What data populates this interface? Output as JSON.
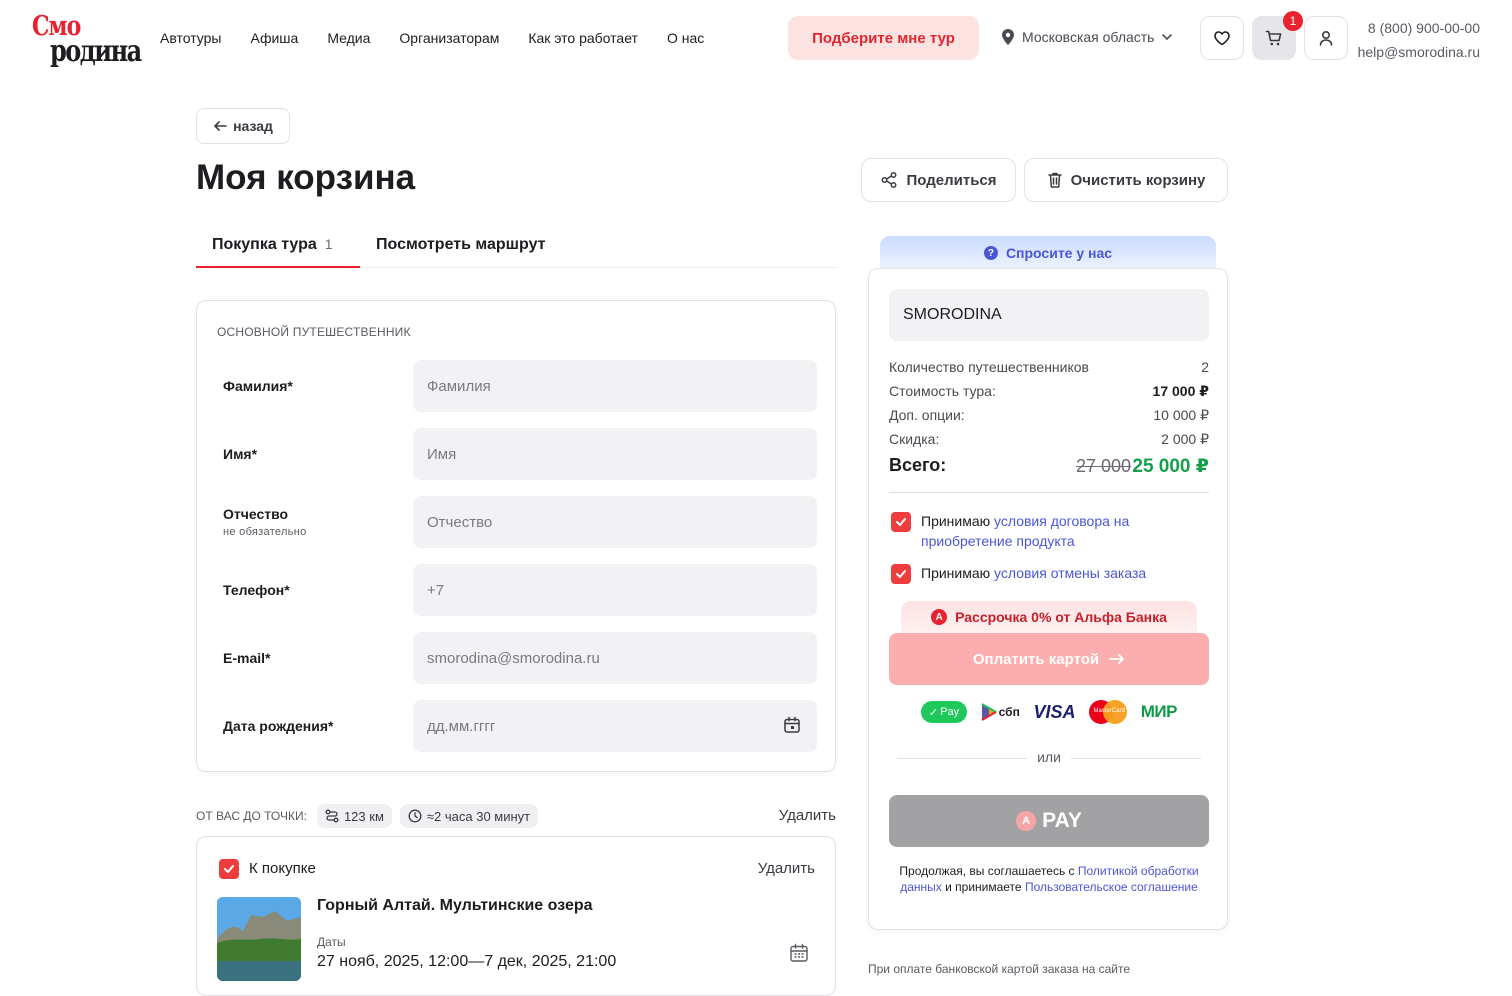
{
  "header": {
    "logo_top": "Смо",
    "logo_bottom": "родина",
    "nav": [
      "Автотуры",
      "Афиша",
      "Медиа",
      "Организаторам",
      "Как это работает",
      "О нас"
    ],
    "pick_tour": "Подберите мне тур",
    "region": "Московская область",
    "cart_count": "1",
    "phone": "8 (800) 900-00-00",
    "email": "help@smorodina.ru"
  },
  "main": {
    "back": "назад",
    "title": "Моя корзина",
    "share": "Поделиться",
    "clear_cart": "Очистить корзину",
    "tabs": [
      {
        "label": "Покупка тура",
        "count": "1"
      },
      {
        "label": "Посмотреть маршрут"
      }
    ]
  },
  "form": {
    "heading": "ОСНОВНОЙ ПУТЕШЕСТВЕННИК",
    "fields": [
      {
        "label": "Фамилия*",
        "placeholder": "Фамилия"
      },
      {
        "label": "Имя*",
        "placeholder": "Имя"
      },
      {
        "label": "Отчество",
        "sublabel": "не обязательно",
        "placeholder": "Отчество"
      },
      {
        "label": "Телефон*",
        "placeholder": "+7"
      },
      {
        "label": "E-mail*",
        "placeholder": "smorodina@smorodina.ru"
      },
      {
        "label": "Дата рождения*",
        "placeholder": "дд.мм.гггг"
      }
    ]
  },
  "distance": {
    "label": "ОТ ВАС ДО ТОЧКИ:",
    "km": "123 км",
    "time": "≈2 часа 30 минут",
    "delete": "Удалить"
  },
  "tour": {
    "buy_label": "К покупке",
    "delete": "Удалить",
    "name": "Горный Алтай. Мультинские озера",
    "dates_label": "Даты",
    "dates": "27 нояб, 2025, 12:00—7 дек, 2025, 21:00"
  },
  "summary": {
    "ask": "Спросите у нас",
    "promo_value": "SMORODINA",
    "rows": [
      {
        "label": "Количество путешественников",
        "value": "2"
      },
      {
        "label": "Стоимость тура:",
        "value": "17 000 ₽"
      },
      {
        "label": "Доп. опции:",
        "value": "10 000 ₽"
      },
      {
        "label": "Скидка:",
        "value": "2 000 ₽"
      }
    ],
    "total_label": "Всего:",
    "total_old": "27 000",
    "total_new": "25 000 ₽",
    "agree1_prefix": "Принимаю",
    "agree1_link": "условия договора на приобретение продукта",
    "agree2_prefix": "Принимаю",
    "agree2_link": "условия отмены заказа",
    "installment": "Рассрочка 0% от Альфа Банка",
    "pay_card": "Оплатить картой",
    "payment_logos": [
      "Pay",
      "сбп",
      "VISA",
      "MasterCard",
      "МИР"
    ],
    "or": "или",
    "apay": "PAY",
    "legal_1": "Продолжая, вы соглашаетесь с",
    "legal_link1": "Политикой обработки данных",
    "legal_2": "и принимаете",
    "legal_link2": "Пользовательское соглашение",
    "footnote": "При оплате банковской картой заказа на сайте"
  },
  "colors": {
    "brand_red": "#e8232f",
    "link_blue": "#4a56d8",
    "total_green": "#14a04a"
  }
}
